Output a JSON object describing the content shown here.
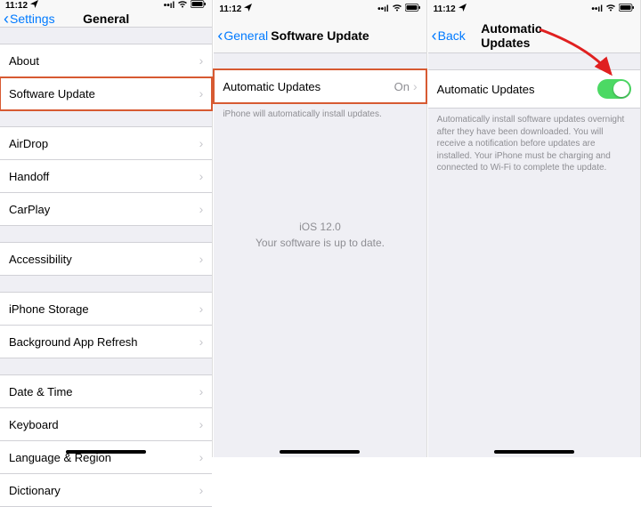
{
  "status": {
    "time": "11:12",
    "location_icon": "↗",
    "signal_icon": "••ıl",
    "wifi_icon": "wifi",
    "battery_icon": "battery"
  },
  "screen1": {
    "back_label": "Settings",
    "title": "General",
    "groups": [
      {
        "rows": [
          {
            "label": "About"
          },
          {
            "label": "Software Update",
            "highlight": true
          }
        ]
      },
      {
        "rows": [
          {
            "label": "AirDrop"
          },
          {
            "label": "Handoff"
          },
          {
            "label": "CarPlay"
          }
        ]
      },
      {
        "rows": [
          {
            "label": "Accessibility"
          }
        ]
      },
      {
        "rows": [
          {
            "label": "iPhone Storage"
          },
          {
            "label": "Background App Refresh"
          }
        ]
      },
      {
        "rows": [
          {
            "label": "Date & Time"
          },
          {
            "label": "Keyboard"
          },
          {
            "label": "Language & Region"
          },
          {
            "label": "Dictionary"
          }
        ]
      }
    ]
  },
  "screen2": {
    "back_label": "General",
    "title": "Software Update",
    "row": {
      "label": "Automatic Updates",
      "value": "On",
      "highlight": true
    },
    "footer": "iPhone will automatically install updates.",
    "center_line1": "iOS 12.0",
    "center_line2": "Your software is up to date."
  },
  "screen3": {
    "back_label": "Back",
    "title": "Automatic Updates",
    "row": {
      "label": "Automatic Updates",
      "toggle_on": true
    },
    "footer": "Automatically install software updates overnight after they have been downloaded. You will receive a notification before updates are installed. Your iPhone must be charging and connected to Wi-Fi to complete the update."
  }
}
